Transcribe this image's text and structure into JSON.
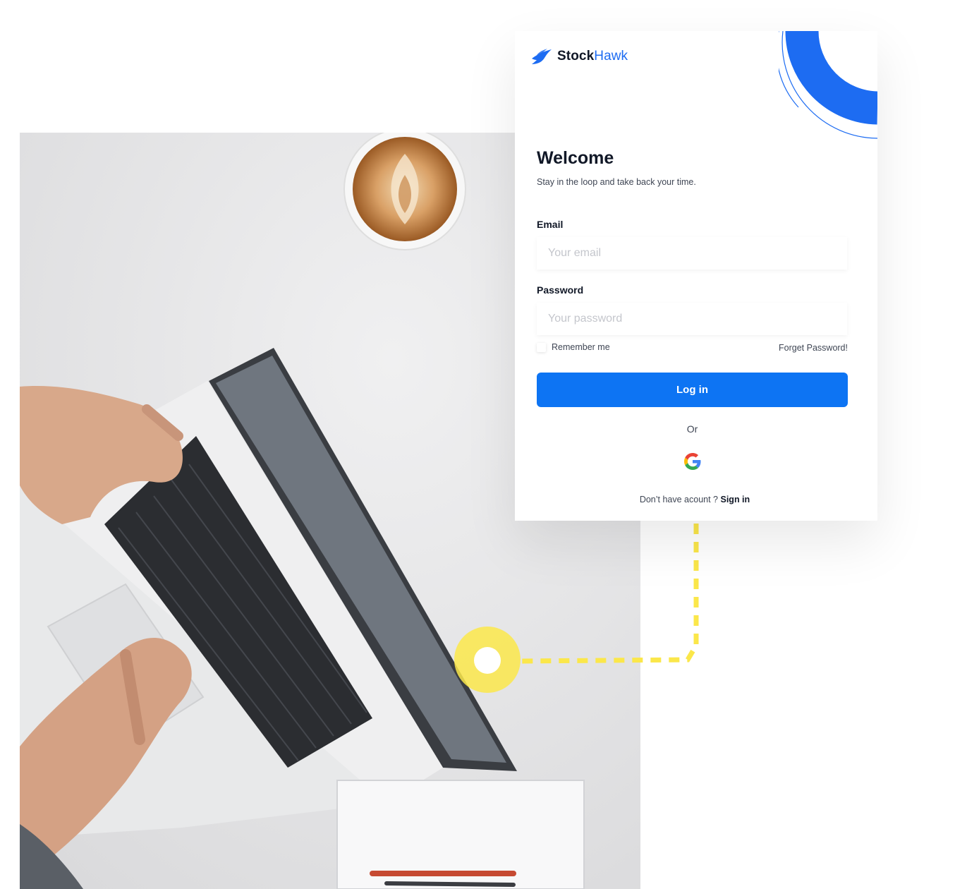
{
  "brand": {
    "name_part1": "Stock",
    "name_part2": "Hawk",
    "accent_color": "#1d6cf2",
    "icon": "bird-logo-icon"
  },
  "login": {
    "title": "Welcome",
    "subtitle": "Stay in the loop and take back your time.",
    "email_label": "Email",
    "email_placeholder": "Your email",
    "password_label": "Password",
    "password_placeholder": "Your password",
    "remember_label": "Remember me",
    "forget_label": "Forget Password!",
    "login_button": "Log in",
    "or_text": "Or",
    "google_icon": "google-icon",
    "signup_prompt": "Don’t have acount ?",
    "signup_link": "Sign in",
    "button_color": "#0d74f3"
  },
  "decor": {
    "connector_color": "#fbe74a",
    "photo": "laptop-workspace-photo"
  }
}
